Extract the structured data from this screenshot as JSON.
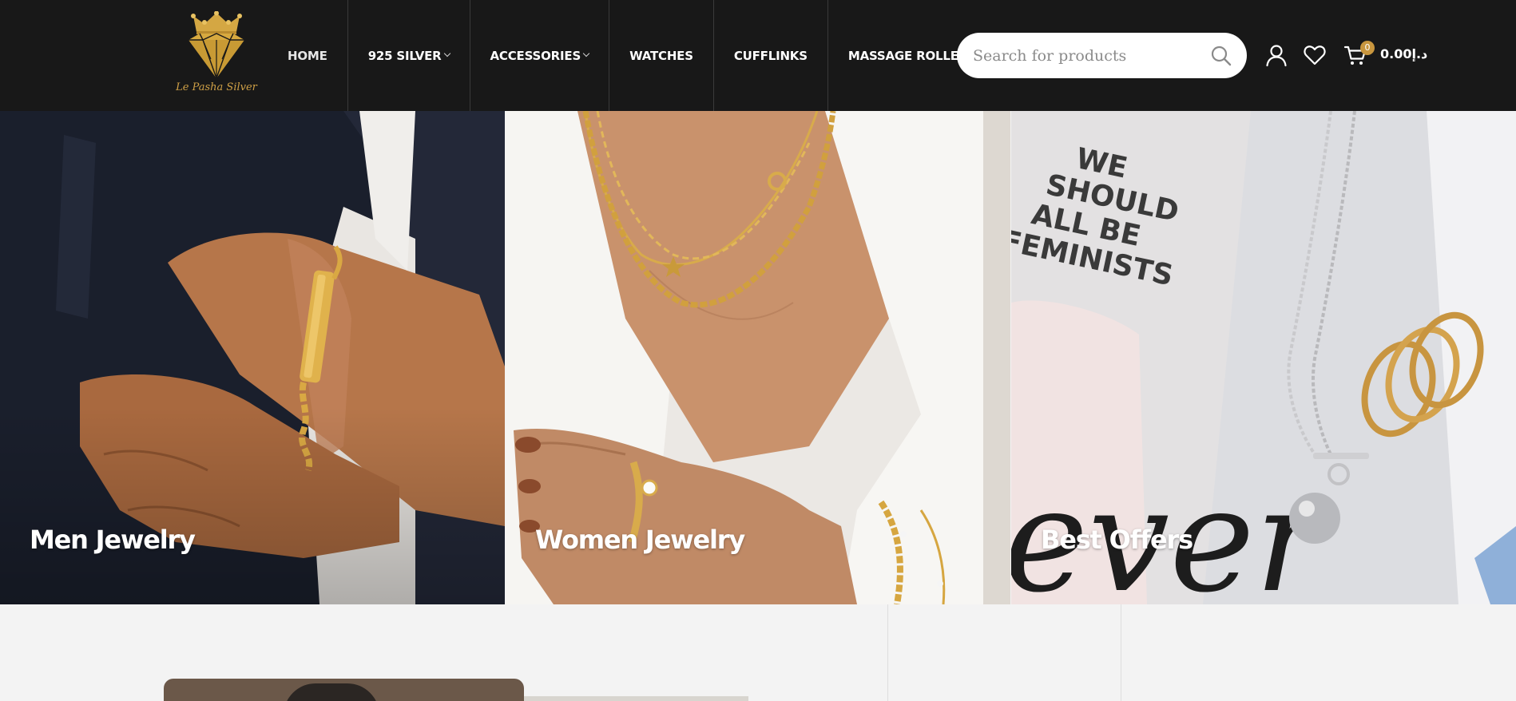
{
  "brand": {
    "logo_text": "Le Pasha Silver",
    "accent_color": "#cfa046"
  },
  "nav": {
    "items": [
      {
        "label": "HOME",
        "has_dropdown": false
      },
      {
        "label": "925 SILVER",
        "has_dropdown": true
      },
      {
        "label": "ACCESSORIES",
        "has_dropdown": true
      },
      {
        "label": "WATCHES",
        "has_dropdown": false
      },
      {
        "label": "CUFFLINKS",
        "has_dropdown": false
      },
      {
        "label": "MASSAGE ROLLER",
        "has_dropdown": false
      }
    ]
  },
  "search": {
    "placeholder": "Search for products",
    "value": "",
    "icon": "search-icon"
  },
  "header_icons": {
    "account": "user-icon",
    "wishlist": "heart-icon",
    "cart": "cart-icon"
  },
  "cart": {
    "count": "0",
    "total": "0.00د.إ",
    "badge_color": "#c8963e"
  },
  "hero": {
    "panels": [
      {
        "title": "Men Jewelry"
      },
      {
        "title": "Women Jewelry"
      },
      {
        "title": "Best Offers"
      }
    ]
  }
}
